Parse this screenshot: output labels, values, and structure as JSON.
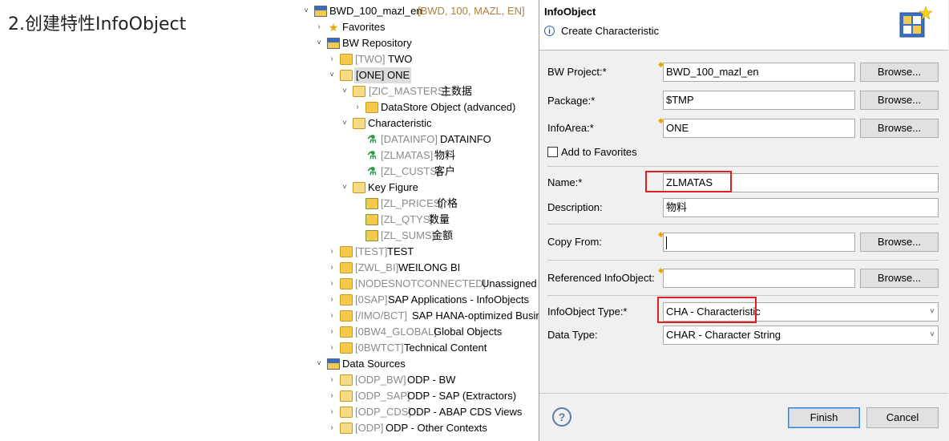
{
  "heading": "2.创建特性InfoObject",
  "tree": {
    "project": {
      "name": "BWD_100_mazl_en",
      "detail": "[BWD, 100, MAZL, EN]"
    },
    "favorites": "Favorites",
    "repository": "BW Repository",
    "two": {
      "tech": "[TWO]",
      "name": "TWO"
    },
    "one": {
      "tech": "[ONE]",
      "name": "ONE"
    },
    "zic": {
      "tech": "[ZIC_MASTERS]",
      "name": "主数据"
    },
    "dso": "DataStore Object (advanced)",
    "characteristic": "Characteristic",
    "datainfo": {
      "tech": "[DATAINFO]",
      "name": "DATAINFO"
    },
    "zlmatas": {
      "tech": "[ZLMATAS]",
      "name": "物料"
    },
    "zlcusts": {
      "tech": "[ZL_CUSTS]",
      "name": "客户"
    },
    "keyfigure": "Key Figure",
    "zlprices": {
      "tech": "[ZL_PRICES]",
      "name": "价格"
    },
    "zlqtys": {
      "tech": "[ZL_QTYS]",
      "name": "数量"
    },
    "zlsums": {
      "tech": "[ZL_SUMS]",
      "name": "金额"
    },
    "test": {
      "tech": "[TEST]",
      "name": "TEST"
    },
    "zwl": {
      "tech": "[ZWL_BI]",
      "name": "WEILONG BI"
    },
    "nodes": {
      "tech": "[NODESNOTCONNECTED]",
      "name": "Unassigned"
    },
    "osap": {
      "tech": "[0SAP]",
      "name": "SAP Applications - InfoObjects"
    },
    "imo": {
      "tech": "[/IMO/BCT]",
      "name": "SAP HANA-optimized Busin"
    },
    "global": {
      "tech": "[0BW4_GLOBAL]",
      "name": "Global Objects"
    },
    "bwtct": {
      "tech": "[0BWTCT]",
      "name": "Technical Content"
    },
    "datasources": "Data Sources",
    "odpbw": {
      "tech": "[ODP_BW]",
      "name": "ODP - BW"
    },
    "odpsap": {
      "tech": "[ODP_SAP]",
      "name": "ODP - SAP (Extractors)"
    },
    "odpcds": {
      "tech": "[ODP_CDS]",
      "name": "ODP - ABAP CDS Views"
    },
    "odp": {
      "tech": "[ODP]",
      "name": "ODP - Other Contexts"
    }
  },
  "dialog": {
    "title": "InfoObject",
    "subtitle": "Create Characteristic",
    "bw_project": {
      "label": "BW Project:*",
      "value": "BWD_100_mazl_en"
    },
    "package": {
      "label": "Package:*",
      "value": "$TMP"
    },
    "infoarea": {
      "label": "InfoArea:*",
      "value": "ONE"
    },
    "browse": "Browse...",
    "add_favorites": "Add to Favorites",
    "name": {
      "label": "Name:*",
      "value": "ZLMATAS"
    },
    "description": {
      "label": "Description:",
      "value": "物料"
    },
    "copy_from": {
      "label": "Copy From:",
      "value": ""
    },
    "referenced": {
      "label": "Referenced InfoObject:",
      "value": ""
    },
    "io_type": {
      "label": "InfoObject Type:*",
      "value": "CHA - Characteristic"
    },
    "data_type": {
      "label": "Data Type:",
      "value": "CHAR - Character String"
    },
    "help": "?",
    "finish": "Finish",
    "cancel": "Cancel"
  }
}
